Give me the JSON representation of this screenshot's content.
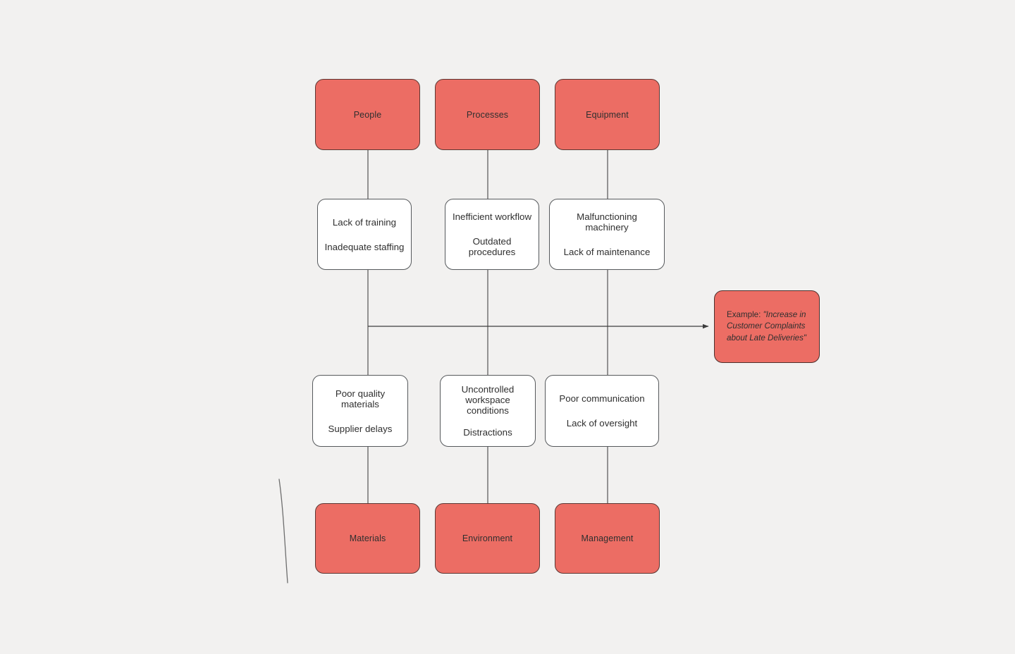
{
  "diagram": {
    "type": "fishbone-ishikawa",
    "background_color": "#f2f1f0",
    "category_color": "#ec6d64",
    "cause_color": "#ffffff",
    "line_color": "#4a4a4a",
    "text_color": "#2f2f2f"
  },
  "categories_top": [
    {
      "label": "People"
    },
    {
      "label": "Processes"
    },
    {
      "label": "Equipment"
    }
  ],
  "causes_top": [
    {
      "lines": [
        "Lack of training",
        "Inadequate staffing"
      ]
    },
    {
      "lines": [
        "Inefficient workflow",
        "Outdated procedures"
      ]
    },
    {
      "lines": [
        "Malfunctioning machinery",
        "Lack of maintenance"
      ]
    }
  ],
  "causes_bottom": [
    {
      "lines": [
        "Poor quality materials",
        "Supplier delays"
      ]
    },
    {
      "lines": [
        "Uncontrolled\nworkspace conditions",
        "Distractions"
      ]
    },
    {
      "lines": [
        "Poor communication",
        "Lack of oversight"
      ]
    }
  ],
  "categories_bottom": [
    {
      "label": "Materials"
    },
    {
      "label": "Environment"
    },
    {
      "label": "Management"
    }
  ],
  "effect": {
    "label": "Example:",
    "quote": "\"Increase in Customer Complaints about Late Deliveries\""
  }
}
